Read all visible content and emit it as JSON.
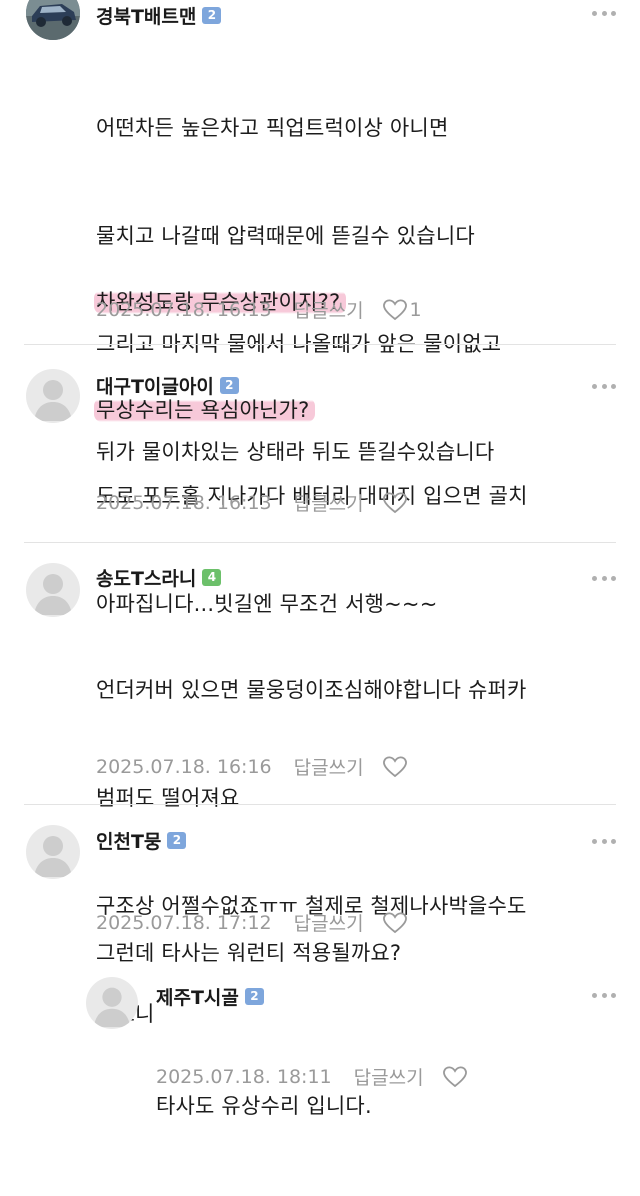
{
  "comments": [
    {
      "author": "경북T배트맨",
      "badge": "2",
      "badge_color": "#7ea6dc",
      "avatar_icon": "car-photo-avatar",
      "lines": [
        "어떤차든 높은차고 픽업트럭이상 아니면",
        "물치고 나갈때 압력때문에 뜯길수 있습니다",
        "그리고 마지막 물에서 나올때가 앞은 물이없고",
        "뒤가 물이차있는 상태라 뒤도 뜯길수있습니다"
      ],
      "highlighted_lines": [
        "차완성도랑 무슨상관이지??",
        "무상수리는 욕심아닌가?"
      ],
      "highlight_color": "#f7c9d9",
      "timestamp": "2025.07.18. 16:13",
      "reply_label": "답글쓰기",
      "like_count": "1"
    },
    {
      "author": "대구T이글아이",
      "badge": "2",
      "badge_color": "#7ea6dc",
      "avatar_icon": "default-user-avatar",
      "lines": [
        "도로 포트홀 지나가다 배터리 대미지 입으면 골치",
        "아파집니다...빗길엔 무조건 서행~~~"
      ],
      "timestamp": "2025.07.18. 16:13",
      "reply_label": "답글쓰기"
    },
    {
      "author": "송도T스라니",
      "badge": "4",
      "badge_color": "#6cc06a",
      "avatar_icon": "default-user-avatar",
      "lines": [
        "언더커버 있으면 물웅덩이조심해야합니다 슈퍼카",
        "범퍼도 떨어져요",
        "구조상 어쩔수없죠ㅠㅠ 철제로 철제나사박을수도",
        "없으니"
      ],
      "timestamp": "2025.07.18. 16:16",
      "reply_label": "답글쓰기"
    },
    {
      "author": "인천T뭉",
      "badge": "2",
      "badge_color": "#7ea6dc",
      "avatar_icon": "default-user-avatar",
      "lines": [
        "그런데 타사는 워런티 적용될까요?"
      ],
      "timestamp": "2025.07.18. 17:12",
      "reply_label": "답글쓰기"
    },
    {
      "author": "제주T시골",
      "badge": "2",
      "badge_color": "#7ea6dc",
      "avatar_icon": "default-user-avatar",
      "is_reply": true,
      "lines": [
        "타사도 유상수리 입니다."
      ],
      "timestamp": "2025.07.18. 18:11",
      "reply_label": "답글쓰기"
    }
  ]
}
